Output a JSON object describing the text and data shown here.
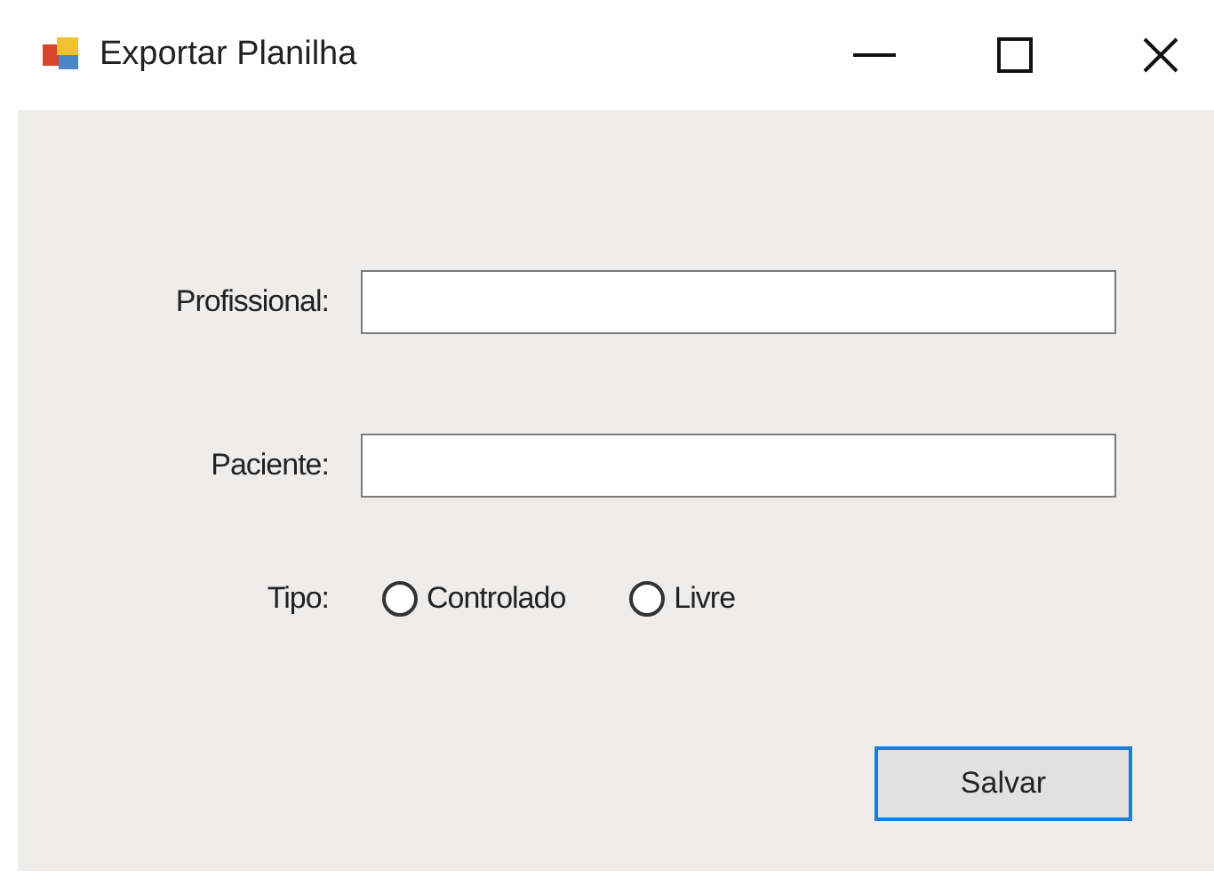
{
  "window": {
    "title": "Exportar Planilha"
  },
  "fields": [
    {
      "label": "Profissional:"
    },
    {
      "label": "Paciente:"
    }
  ],
  "tipo": {
    "label": "Tipo:",
    "options": [
      {
        "label": "Controlado",
        "selected": false
      },
      {
        "label": "Livre",
        "selected": false
      }
    ]
  },
  "buttons": [
    {
      "label": "Salvar",
      "focused": true
    }
  ]
}
